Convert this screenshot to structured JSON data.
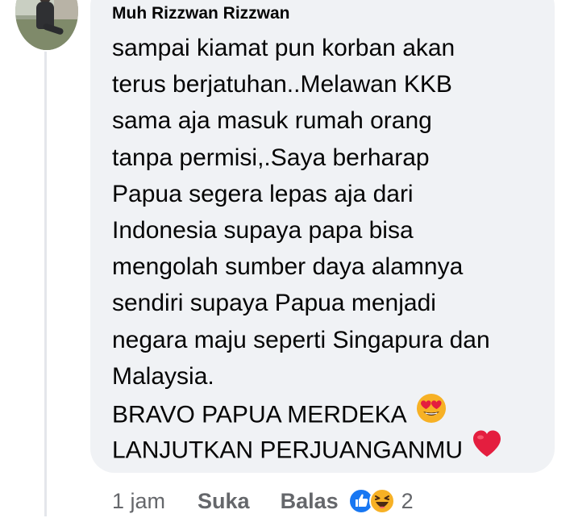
{
  "comment": {
    "author": "Muh Rizzwan Rizzwan",
    "lines": [
      "sampai kiamat pun korban akan",
      "terus berjatuhan..Melawan KKB",
      "sama aja masuk rumah orang",
      "tanpa permisi,.Saya berharap",
      "Papua segera lepas aja dari",
      "Indonesia supaya papa bisa",
      "mengolah sumber daya alamnya",
      "sendiri supaya Papua menjadi",
      "negara maju seperti Singapura dan",
      "Malaysia.",
      "BRAVO PAPUA MERDEKA",
      "LANJUTKAN PERJUANGANMU"
    ],
    "emojis": {
      "line_11": "heart-eyes-emoji",
      "line_12": "red-heart-emoji"
    }
  },
  "actions": {
    "time": "1 jam",
    "like_label": "Suka",
    "reply_label": "Balas",
    "reaction_icons": [
      "like-icon",
      "haha-icon"
    ],
    "reaction_count": "2"
  },
  "colors": {
    "bubble": "#f0f2f5",
    "secondary_text": "#65676b",
    "like_blue": "#1877f2",
    "reaction_yellow": "#f7b125",
    "heart_red": "#e41e3f"
  }
}
